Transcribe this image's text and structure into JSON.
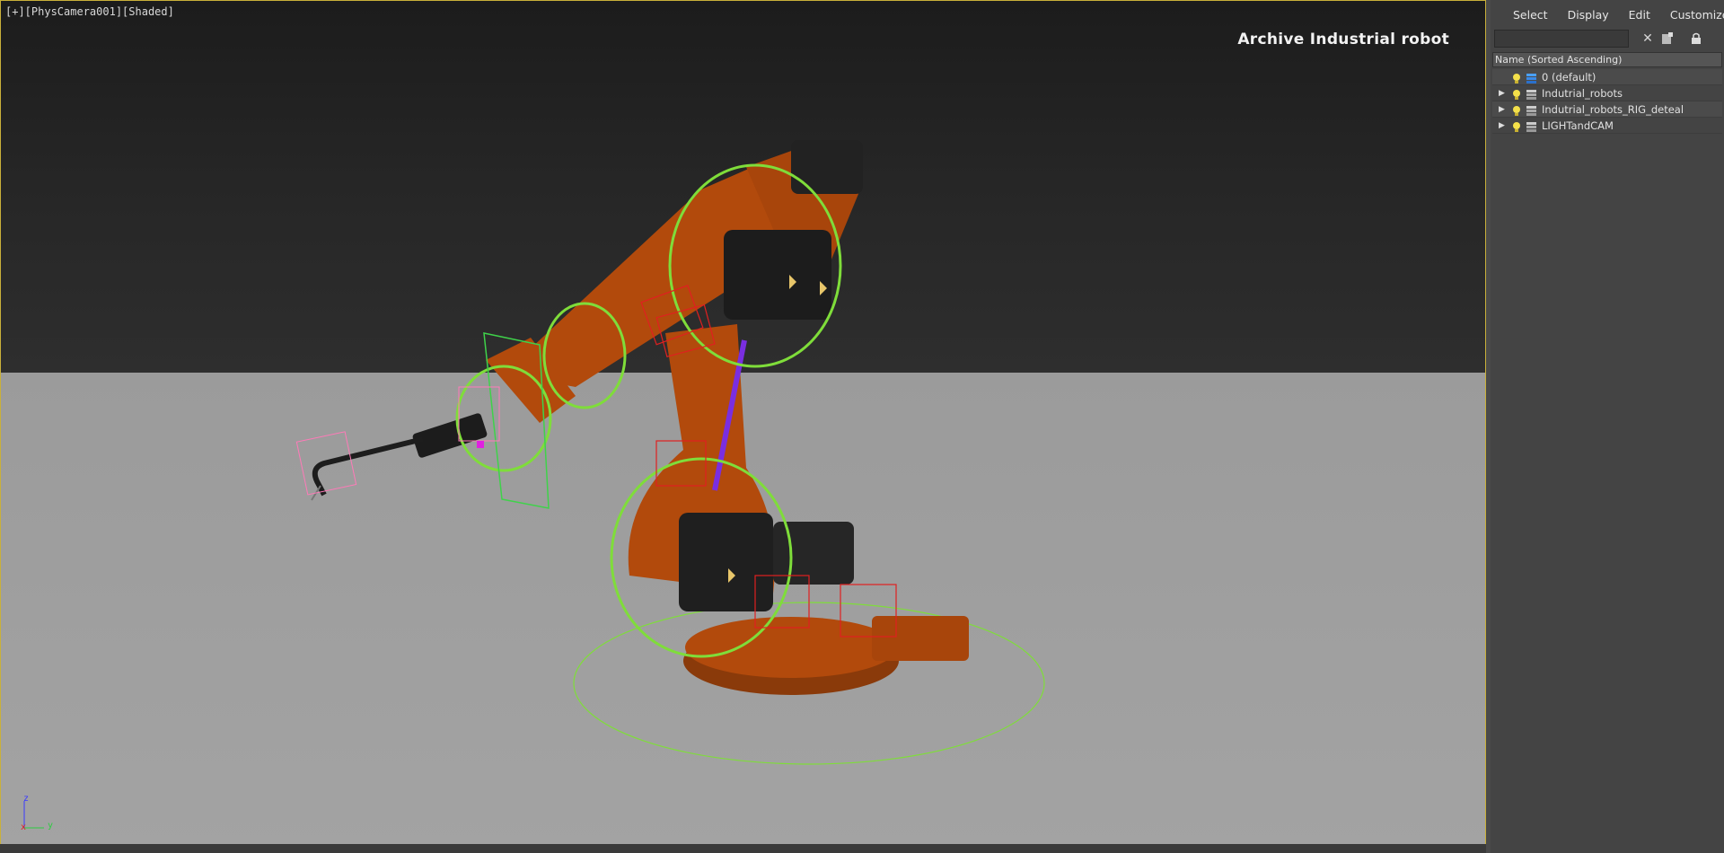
{
  "viewport": {
    "label": "[+][PhysCamera001][Shaded]",
    "title": "Archive Industrial robot",
    "axis": {
      "z": "z",
      "y": "y",
      "x": "x"
    }
  },
  "panel": {
    "menu": [
      "Select",
      "Display",
      "Edit",
      "Customize"
    ],
    "search": {
      "value": "",
      "placeholder": ""
    },
    "column_header": "Name (Sorted Ascending)",
    "layers": [
      {
        "name": "0 (default)",
        "expandable": false,
        "active": true
      },
      {
        "name": "Indutrial_robots",
        "expandable": true,
        "active": false
      },
      {
        "name": "Indutrial_robots_RIG_deteal",
        "expandable": true,
        "active": false
      },
      {
        "name": "LIGHTandCAM",
        "expandable": true,
        "active": false
      }
    ]
  },
  "colors": {
    "robot_orange": "#b24a0c",
    "viewport_border": "#c9b03a",
    "helper_green": "#7fdd3a",
    "helper_red": "#e02020",
    "bulb_yellow": "#f4e04a"
  }
}
